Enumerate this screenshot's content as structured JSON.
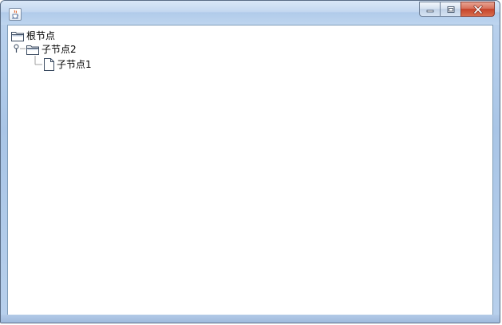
{
  "window": {
    "title": "",
    "app_icon": "java-cup-icon",
    "buttons": {
      "minimize": "minimize-icon",
      "maximize": "maximize-icon",
      "close": "close-icon"
    }
  },
  "tree": {
    "root": {
      "label": "根节点",
      "icon": "folder-icon"
    },
    "children": [
      {
        "label": "子节点2",
        "icon": "folder-icon",
        "expanded": true,
        "children": [
          {
            "label": "子节点1",
            "icon": "file-icon"
          }
        ]
      }
    ]
  },
  "colors": {
    "frame": "#a9c5e6",
    "close_button": "#c5432a",
    "tree_line": "#a0a0a0"
  }
}
